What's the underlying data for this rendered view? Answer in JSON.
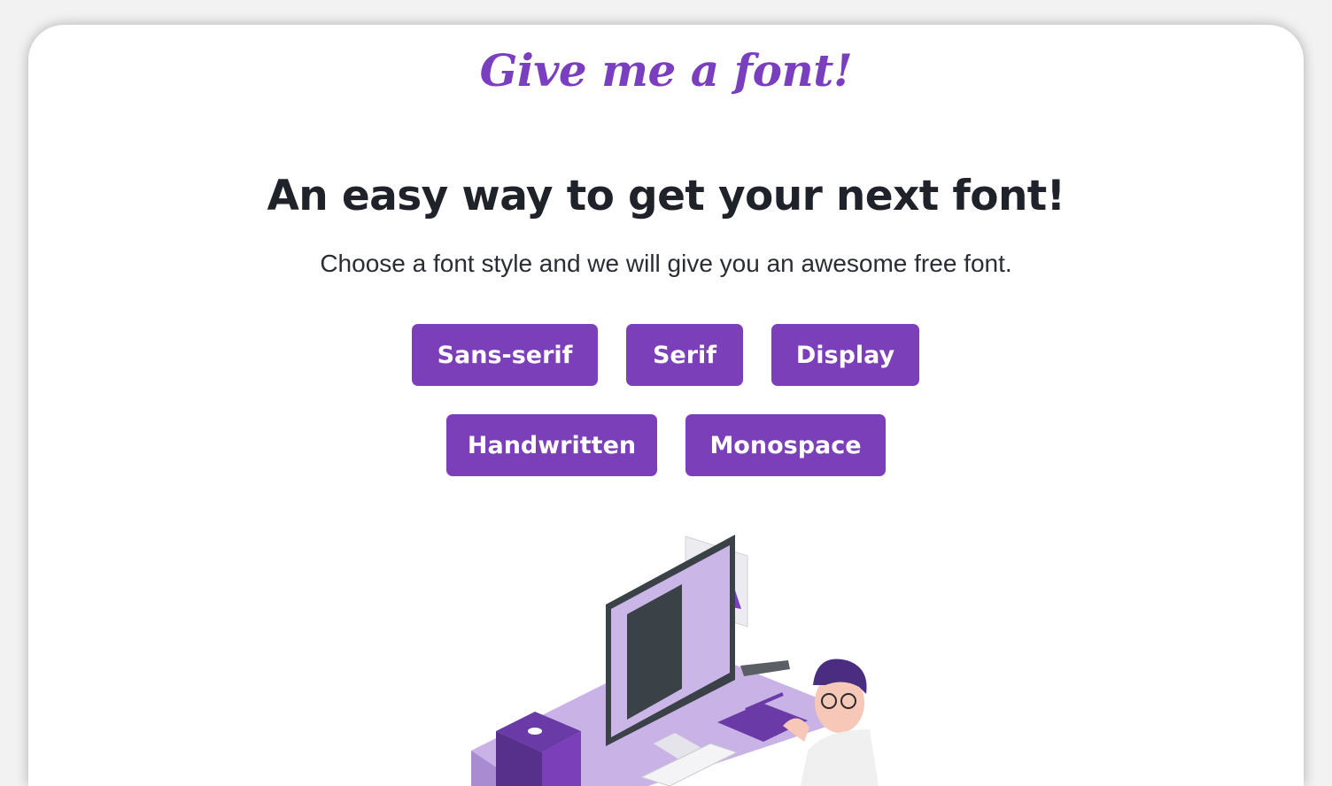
{
  "header": {
    "logo_text": "Give me a font!"
  },
  "hero": {
    "headline": "An easy way to get your next font!",
    "subheadline": "Choose a font style and we will give you an awesome free font."
  },
  "font_styles": {
    "sans_serif": "Sans-serif",
    "serif": "Serif",
    "display": "Display",
    "handwritten": "Handwritten",
    "monospace": "Monospace"
  },
  "colors": {
    "accent": "#7b3fb9",
    "heading": "#1f2229",
    "background": "#ffffff"
  },
  "illustration": {
    "icon": "designer-at-desk-illustration"
  }
}
